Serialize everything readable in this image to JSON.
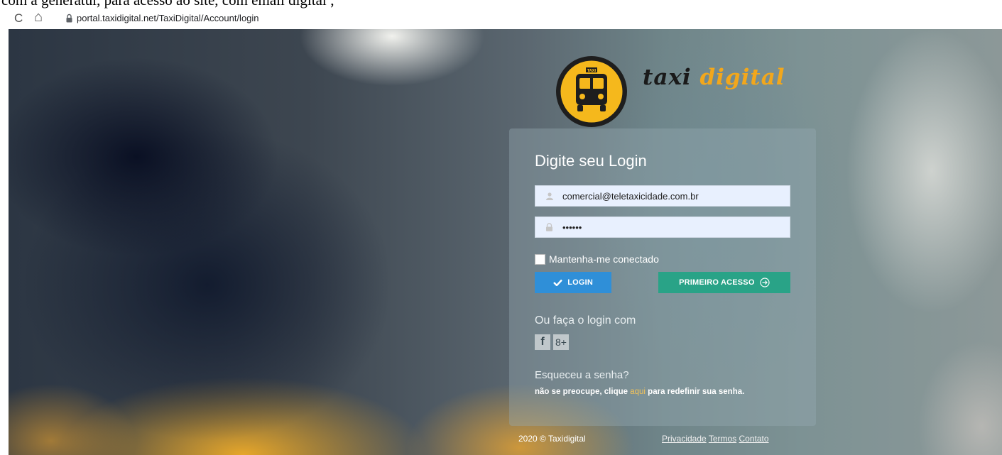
{
  "document": {
    "top_text": "com a generatul, para acesso ao site, com email digital ;"
  },
  "browser": {
    "reload_glyph": "C",
    "home_glyph": "⌂",
    "url": "portal.taxidigital.net/TaxiDigital/Account/login"
  },
  "brand": {
    "name_part1": "taxi",
    "name_part2": "digital",
    "logo_badge_text": "TAXI",
    "logo_color": "#f5b81c",
    "accent_color": "#f2a71c"
  },
  "login": {
    "title": "Digite seu Login",
    "email_value": "comercial@teletaxicidade.com.br",
    "password_value": "••••••",
    "remember_label": "Mantenha-me conectado",
    "login_button": "LOGIN",
    "first_access_button": "PRIMEIRO ACESSO",
    "social_title": "Ou faça o login com",
    "social": {
      "facebook": "f",
      "google": "8+"
    },
    "forgot_title": "Esqueceu a senha?",
    "forgot_text_before": "não se preocupe, clique",
    "forgot_link": "aqui",
    "forgot_text_after": "para redefinir sua senha."
  },
  "footer": {
    "copyright": "2020 © Taxidigital",
    "links": [
      "Privacidade",
      "Termos",
      "Contato"
    ]
  },
  "colors": {
    "login_button": "#2f8fd8",
    "first_access_button": "#29a387"
  }
}
